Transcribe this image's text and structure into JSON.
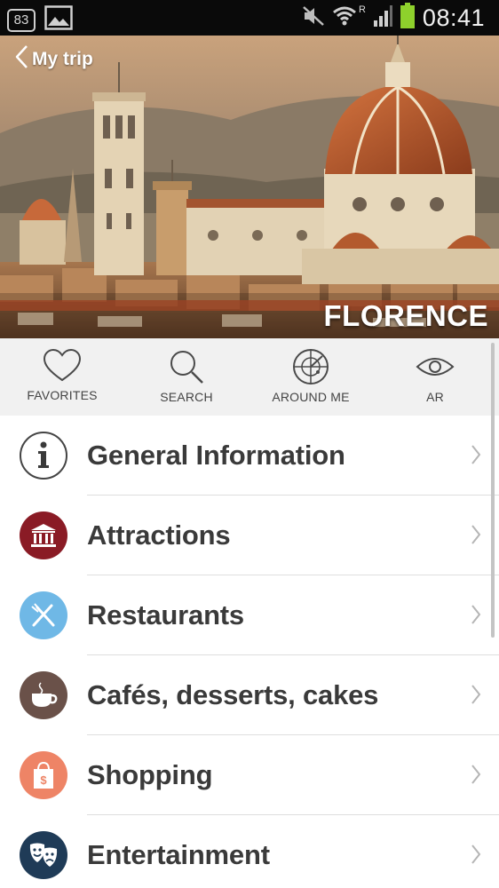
{
  "status_bar": {
    "notification_count": "83",
    "time": "08:41",
    "roaming_indicator": "R",
    "icons": [
      "notification-count-icon",
      "image-notification-icon",
      "mute-icon",
      "wifi-icon",
      "signal-icon",
      "battery-icon"
    ]
  },
  "header": {
    "back_label": "My trip",
    "city_title": "FLORENCE"
  },
  "toolbar": {
    "items": [
      {
        "label": "FAVORITES",
        "icon": "heart-icon"
      },
      {
        "label": "SEARCH",
        "icon": "search-icon"
      },
      {
        "label": "AROUND ME",
        "icon": "radar-icon"
      },
      {
        "label": "AR",
        "icon": "eye-icon"
      }
    ]
  },
  "menu": {
    "items": [
      {
        "label": "General Information",
        "icon": "info-icon",
        "color": "#ffffff"
      },
      {
        "label": "Attractions",
        "icon": "museum-icon",
        "color": "#8a1b25"
      },
      {
        "label": "Restaurants",
        "icon": "fork-knife-icon",
        "color": "#6fb8e6"
      },
      {
        "label": "Cafés, desserts, cakes",
        "icon": "coffee-cup-icon",
        "color": "#6a5149"
      },
      {
        "label": "Shopping",
        "icon": "shopping-bag-icon",
        "color": "#ee8466"
      },
      {
        "label": "Entertainment",
        "icon": "theater-masks-icon",
        "color": "#1f3b57"
      }
    ]
  },
  "colors": {
    "status_bar_bg": "#0a0a0a",
    "toolbar_bg": "#f1f1f1",
    "label_text": "#3a3a3a",
    "battery": "#8ed12c"
  }
}
